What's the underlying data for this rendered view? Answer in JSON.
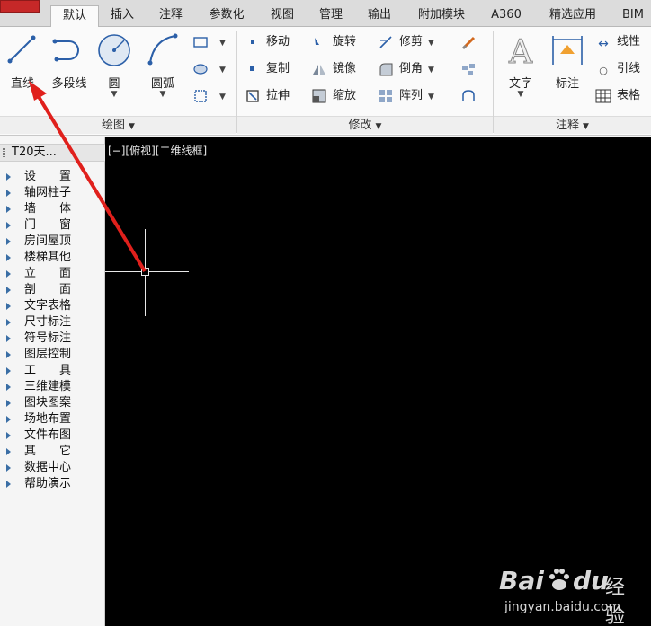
{
  "tabs": [
    {
      "label": "默认",
      "active": true
    },
    {
      "label": "插入"
    },
    {
      "label": "注释"
    },
    {
      "label": "参数化"
    },
    {
      "label": "视图"
    },
    {
      "label": "管理"
    },
    {
      "label": "输出"
    },
    {
      "label": "附加模块"
    },
    {
      "label": "A360"
    },
    {
      "label": "精选应用"
    },
    {
      "label": "BIM"
    }
  ],
  "ribbon": {
    "draw": {
      "title": "绘图",
      "line": "直线",
      "polyline": "多段线",
      "circle": "圆",
      "arc": "圆弧"
    },
    "modify": {
      "title": "修改",
      "move": "移动",
      "rotate": "旋转",
      "trim": "修剪",
      "copy": "复制",
      "mirror": "镜像",
      "fillet": "倒角",
      "stretch": "拉伸",
      "scale": "缩放",
      "array": "阵列"
    },
    "annotation": {
      "title": "注释",
      "text": "文字",
      "dimension": "标注",
      "linear": "线性",
      "leader": "引线",
      "table": "表格"
    }
  },
  "t20": {
    "title": "T20天...",
    "items": [
      "设　　置",
      "轴网柱子",
      "墙　　体",
      "门　　窗",
      "房间屋顶",
      "楼梯其他",
      "立　　面",
      "剖　　面",
      "文字表格",
      "尺寸标注",
      "符号标注",
      "图层控制",
      "工　　具",
      "三维建模",
      "图块图案",
      "场地布置",
      "文件布图",
      "其　　它",
      "数据中心",
      "帮助演示"
    ]
  },
  "viewport": {
    "label": "[−][俯视][二维线框]"
  },
  "watermark": {
    "brand": "Bai",
    "brand2": "du",
    "cn": "经验",
    "url": "jingyan.baidu.com"
  },
  "colors": {
    "accent_red": "#e0201c",
    "canvas_bg": "#000000",
    "ribbon_bg": "#fafafa"
  }
}
